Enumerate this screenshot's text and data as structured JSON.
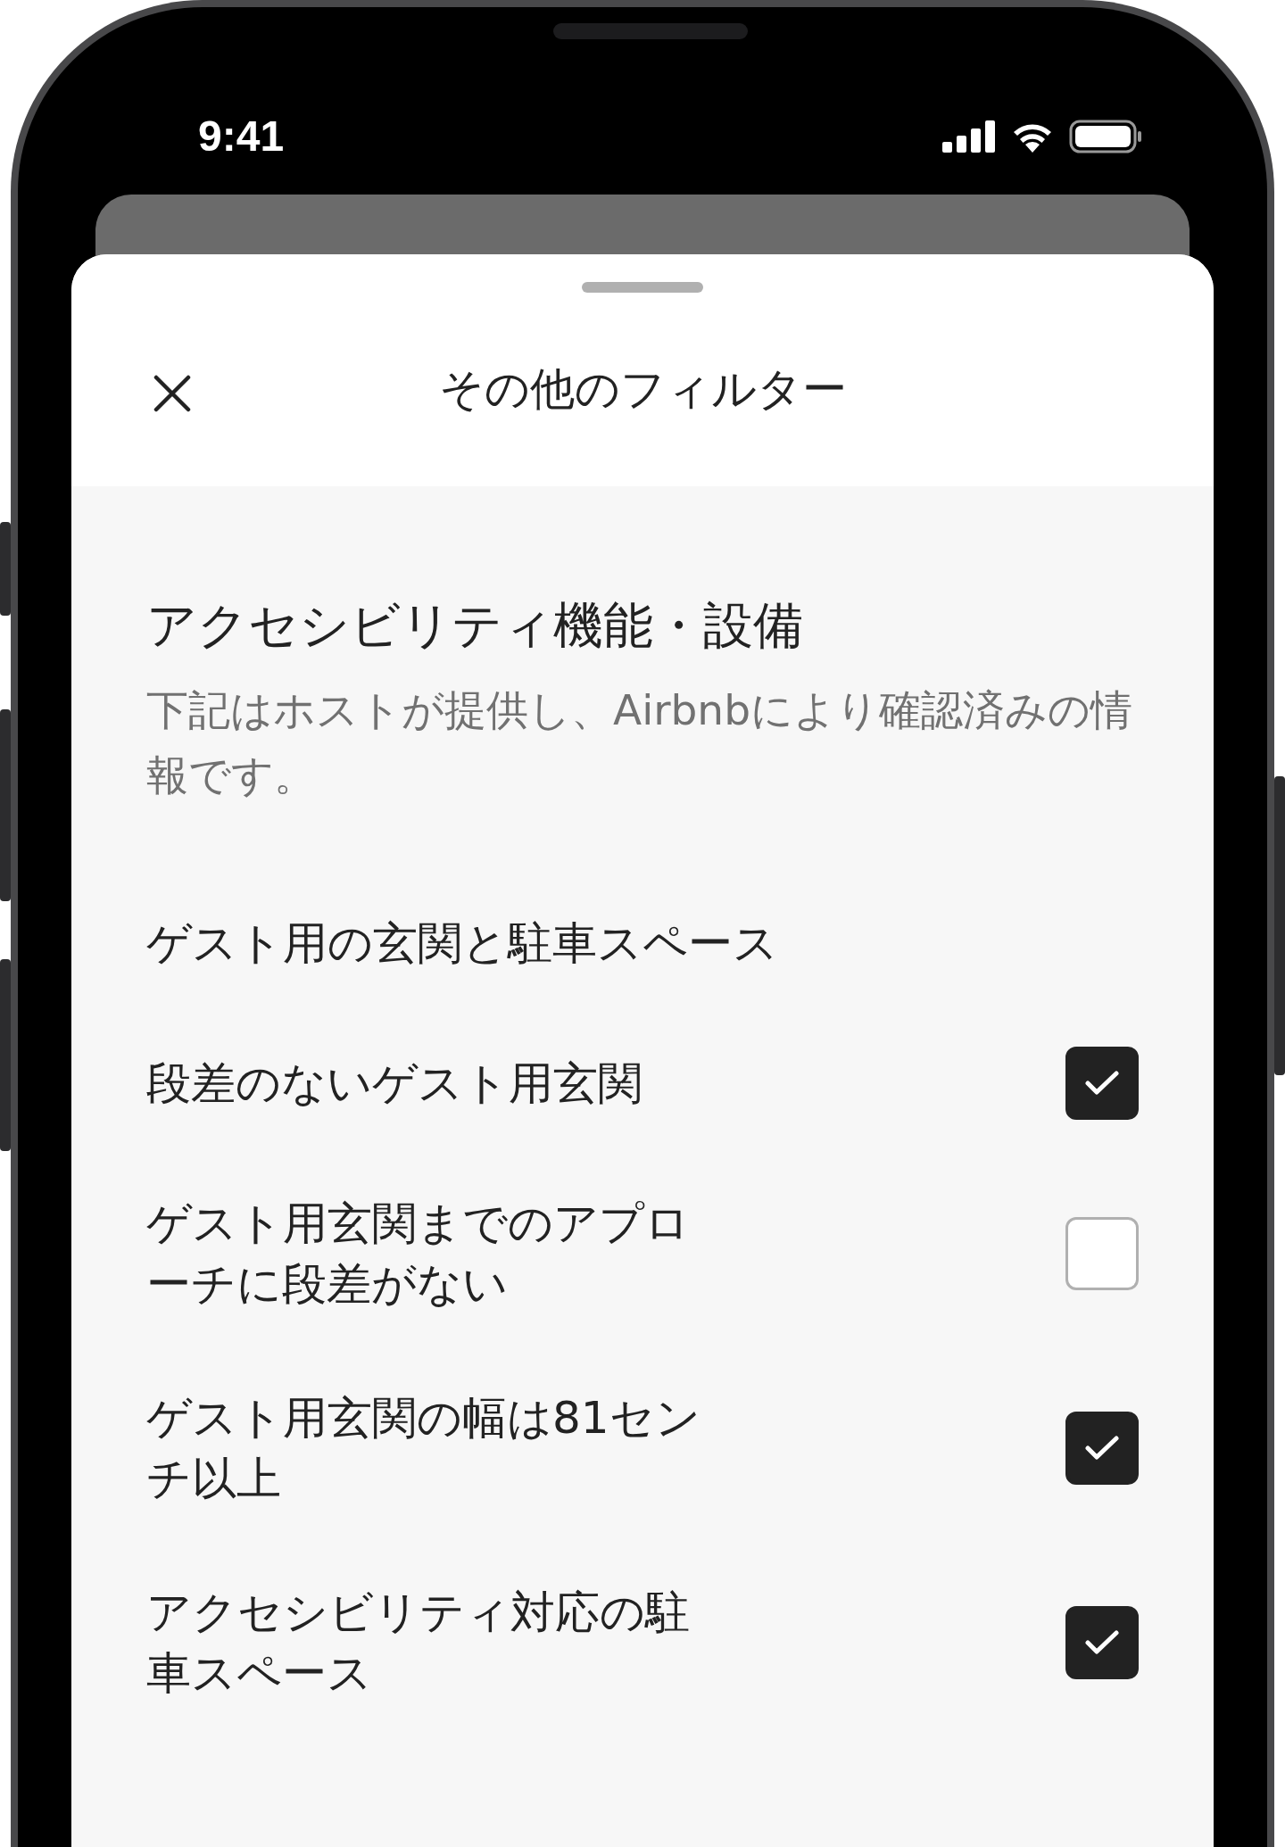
{
  "status_bar": {
    "time": "9:41"
  },
  "sheet": {
    "title": "その他のフィルター"
  },
  "section": {
    "title": "アクセシビリティ機能・設備",
    "description": "下記はホストが提供し、Airbnbにより確認済みの情報です。"
  },
  "group": {
    "title": "ゲスト用の玄関と駐車スペース",
    "options": [
      {
        "label": "段差のないゲスト用玄関",
        "checked": true
      },
      {
        "label": "ゲスト用玄関までのアプローチに段差がない",
        "checked": false
      },
      {
        "label": "ゲスト用玄関の幅は81センチ以上",
        "checked": true
      },
      {
        "label": "アクセシビリティ対応の駐車スペース",
        "checked": true
      }
    ]
  }
}
